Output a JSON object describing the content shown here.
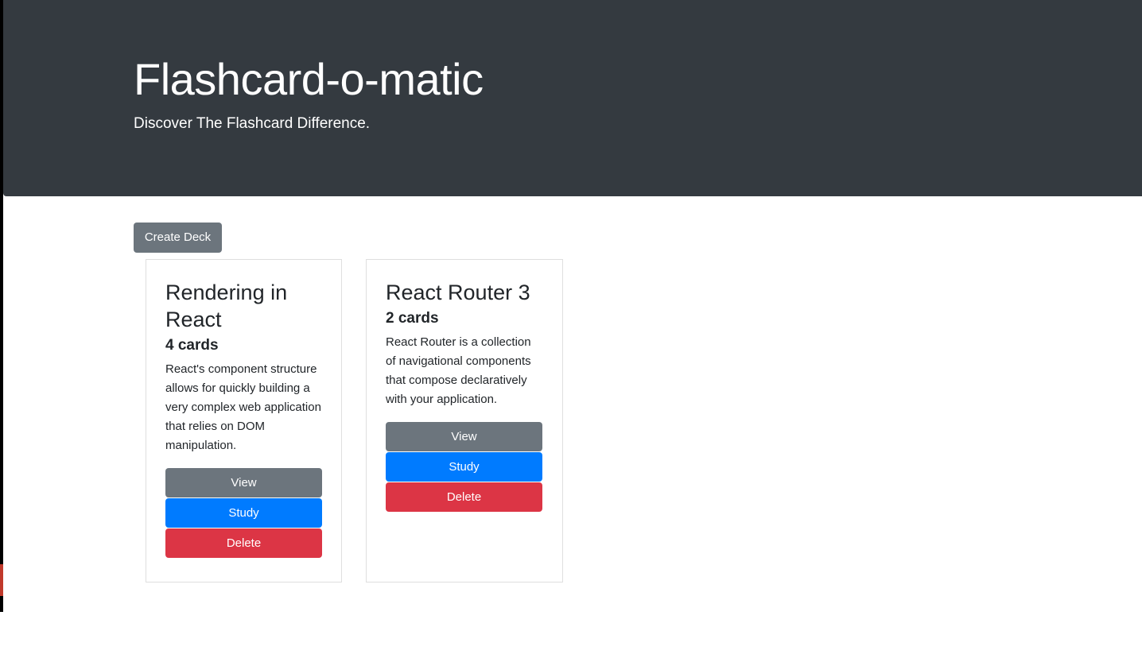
{
  "header": {
    "title": "Flashcard-o-matic",
    "subtitle": "Discover The Flashcard Difference."
  },
  "toolbar": {
    "create_label": "Create Deck"
  },
  "decks": [
    {
      "name": "Rendering in React",
      "count": "4 cards",
      "description": "React's component structure allows for quickly building a very complex web application that relies on DOM manipulation.",
      "view_label": "View",
      "study_label": "Study",
      "delete_label": "Delete"
    },
    {
      "name": "React Router 3",
      "count": "2 cards",
      "description": "React Router is a collection of navigational components that compose declaratively with your application.",
      "view_label": "View",
      "study_label": "Study",
      "delete_label": "Delete"
    }
  ],
  "colors": {
    "header_bg": "#343a40",
    "secondary": "#6c757d",
    "primary": "#007bff",
    "danger": "#dc3545"
  }
}
